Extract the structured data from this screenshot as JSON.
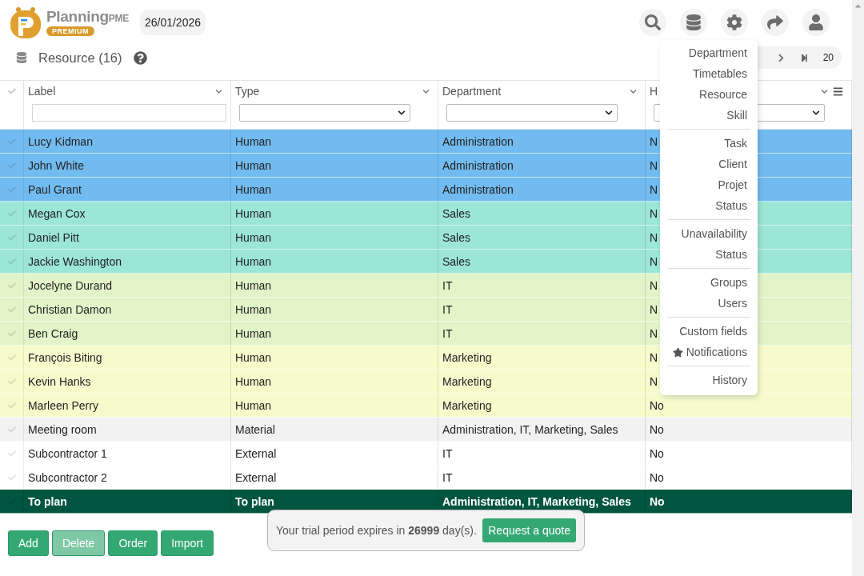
{
  "header": {
    "logo": {
      "name": "Planning",
      "suffix": "PME",
      "badge": "PREMIUM"
    },
    "date": "26/01/2026"
  },
  "title": "Resource (16)",
  "pagination": {
    "page_size": "20"
  },
  "table": {
    "columns": [
      {
        "label": "Label",
        "kind": "text"
      },
      {
        "label": "Type",
        "kind": "select"
      },
      {
        "label": "Department",
        "kind": "select"
      },
      {
        "label": "H",
        "kind": "select"
      }
    ],
    "rows": [
      {
        "cells": [
          "Lucy Kidman",
          "Human",
          "Administration",
          "N"
        ],
        "color": "#72bbf0"
      },
      {
        "cells": [
          "John White",
          "Human",
          "Administration",
          "N"
        ],
        "color": "#72bbf0"
      },
      {
        "cells": [
          "Paul Grant",
          "Human",
          "Administration",
          "N"
        ],
        "color": "#72bbf0"
      },
      {
        "cells": [
          "Megan Cox",
          "Human",
          "Sales",
          "N"
        ],
        "color": "#9ce6d6"
      },
      {
        "cells": [
          "Daniel Pitt",
          "Human",
          "Sales",
          "N"
        ],
        "color": "#9ce6d6"
      },
      {
        "cells": [
          "Jackie Washington",
          "Human",
          "Sales",
          "N"
        ],
        "color": "#9ce6d6"
      },
      {
        "cells": [
          "Jocelyne Durand",
          "Human",
          "IT",
          "N"
        ],
        "color": "#e2f5c9"
      },
      {
        "cells": [
          "Christian Damon",
          "Human",
          "IT",
          "N"
        ],
        "color": "#e2f5c9"
      },
      {
        "cells": [
          "Ben Craig",
          "Human",
          "IT",
          "N"
        ],
        "color": "#e2f5c9"
      },
      {
        "cells": [
          "François Biting",
          "Human",
          "Marketing",
          "N"
        ],
        "color": "#f6fbcc"
      },
      {
        "cells": [
          "Kevin Hanks",
          "Human",
          "Marketing",
          "N"
        ],
        "color": "#f6fbcc"
      },
      {
        "cells": [
          "Marleen Perry",
          "Human",
          "Marketing",
          "No"
        ],
        "color": "#f6fbcc"
      },
      {
        "cells": [
          "Meeting room",
          "Material",
          "Administration, IT, Marketing, Sales",
          "No"
        ],
        "color": "#f2f2f2"
      },
      {
        "cells": [
          "Subcontractor 1",
          "External",
          "IT",
          "No"
        ],
        "color": "#ffffff"
      },
      {
        "cells": [
          "Subcontractor 2",
          "External",
          "IT",
          "No"
        ],
        "color": "#ffffff"
      },
      {
        "cells": [
          "To plan",
          "To plan",
          "Administration, IT, Marketing, Sales",
          "No"
        ],
        "color": "#00553f"
      }
    ]
  },
  "menu": {
    "groups": [
      [
        {
          "label": "Department",
          "starred": false
        },
        {
          "label": "Timetables",
          "starred": false
        },
        {
          "label": "Resource",
          "starred": false
        },
        {
          "label": "Skill",
          "starred": false
        }
      ],
      [
        {
          "label": "Task",
          "starred": false
        },
        {
          "label": "Client",
          "starred": false
        },
        {
          "label": "Projet",
          "starred": false
        },
        {
          "label": "Status",
          "starred": false
        }
      ],
      [
        {
          "label": "Unavailability",
          "starred": false
        },
        {
          "label": "Status",
          "starred": false
        }
      ],
      [
        {
          "label": "Groups",
          "starred": false
        },
        {
          "label": "Users",
          "starred": false
        }
      ],
      [
        {
          "label": "Custom fields",
          "starred": false
        },
        {
          "label": "Notifications",
          "starred": true
        }
      ],
      [
        {
          "label": "History",
          "starred": false
        }
      ]
    ]
  },
  "buttons": [
    {
      "label": "Add",
      "disabled": false
    },
    {
      "label": "Delete",
      "disabled": true
    },
    {
      "label": "Order",
      "disabled": false
    },
    {
      "label": "Import",
      "disabled": false
    }
  ],
  "trial": {
    "text": "Your trial period expires in **26999** day(s).",
    "button": "Request a quote"
  }
}
